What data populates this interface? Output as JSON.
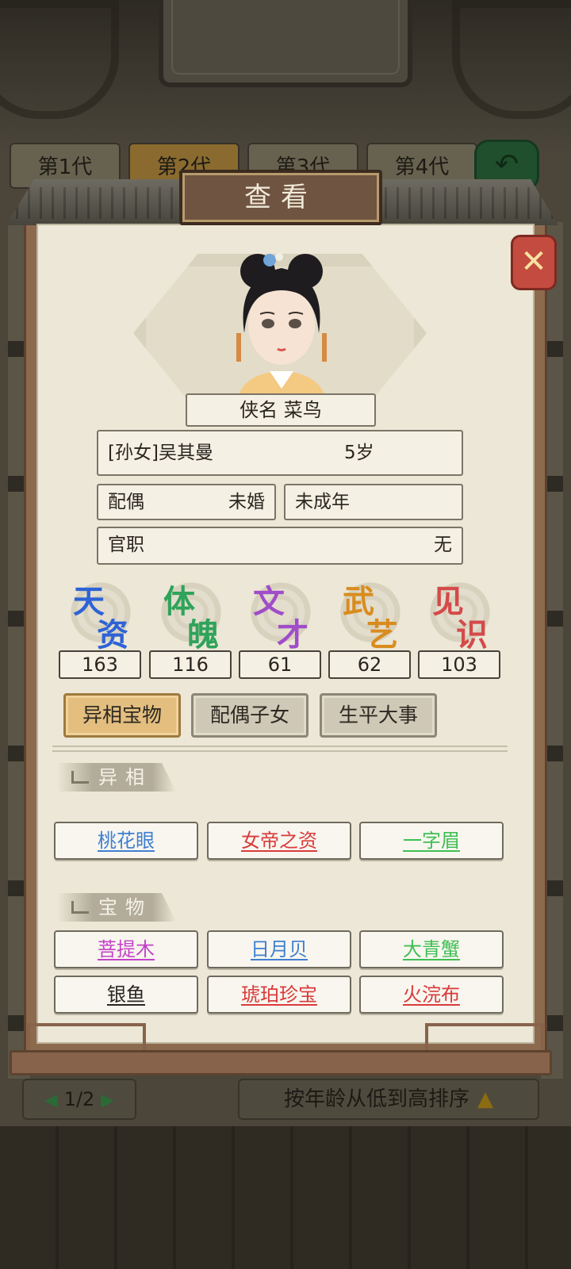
{
  "generations": [
    "第1代",
    "第2代",
    "第3代",
    "第4代"
  ],
  "dialog": {
    "title": "查看",
    "name_line": "侠名 菜鸟",
    "relation_name": "[孙女]吴其曼",
    "age": "5岁",
    "spouse_label": "配偶",
    "spouse_value": "未婚",
    "adult_status": "未成年",
    "office_label": "官职",
    "office_value": "无"
  },
  "stats": [
    {
      "c1": "天",
      "c2": "资",
      "value": "163",
      "color": "#2e63d6"
    },
    {
      "c1": "体",
      "c2": "魄",
      "value": "116",
      "color": "#2fa35a"
    },
    {
      "c1": "文",
      "c2": "才",
      "value": "61",
      "color": "#a04dc9"
    },
    {
      "c1": "武",
      "c2": "艺",
      "value": "62",
      "color": "#d98c1e"
    },
    {
      "c1": "见",
      "c2": "识",
      "value": "103",
      "color": "#d44a4a"
    }
  ],
  "tabs": [
    "异相宝物",
    "配偶子女",
    "生平大事"
  ],
  "sections": {
    "traits_title": "异相",
    "treasures_title": "宝物"
  },
  "traits": [
    {
      "label": "桃花眼",
      "color": "#3f7fd1"
    },
    {
      "label": "女帝之资",
      "color": "#d93b3b"
    },
    {
      "label": "一字眉",
      "color": "#3fbf52"
    }
  ],
  "treasures": [
    {
      "label": "菩提木",
      "color": "#c442c9"
    },
    {
      "label": "日月贝",
      "color": "#3f7fd1"
    },
    {
      "label": "大青蟹",
      "color": "#3fbf52"
    },
    {
      "label": "银鱼",
      "color": "#2b2520"
    },
    {
      "label": "琥珀珍宝",
      "color": "#d93b3b"
    },
    {
      "label": "火浣布",
      "color": "#d93b3b"
    }
  ],
  "footer": {
    "page": "1/2",
    "sort_label": "按年龄从低到高排序"
  }
}
